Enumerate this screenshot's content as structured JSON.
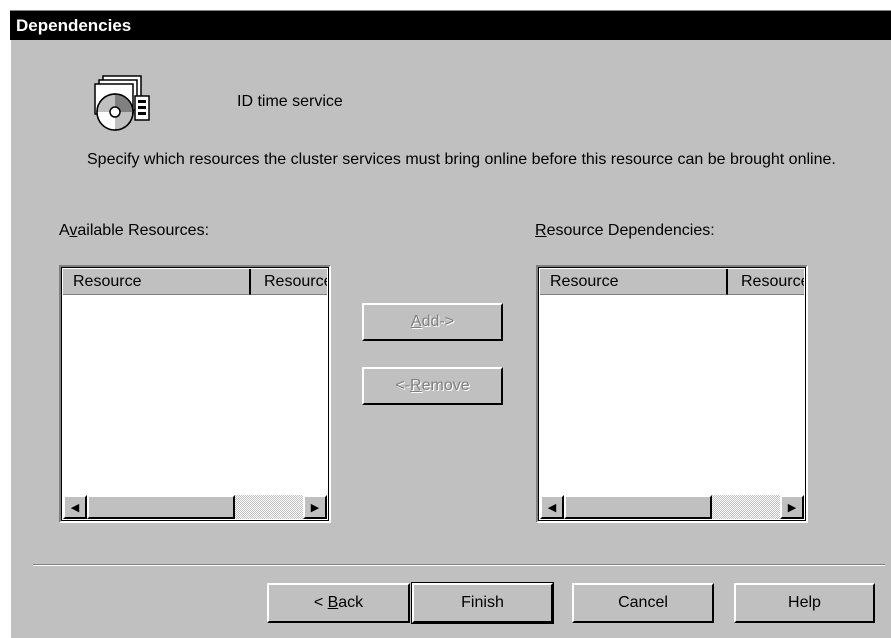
{
  "window": {
    "title": "Dependencies"
  },
  "resource_name": "ID time service",
  "instructions": "Specify which resources the cluster services must bring online before this resource can be brought online.",
  "available": {
    "label_pre": "A",
    "label_mnemonic": "v",
    "label_post": "ailable Resources:",
    "columns": [
      "Resource",
      "Resource Type"
    ],
    "items": []
  },
  "dependencies": {
    "label_pre": "",
    "label_mnemonic": "R",
    "label_post": "esource Dependencies:",
    "columns": [
      "Resource",
      "Resource Type"
    ],
    "items": []
  },
  "buttons": {
    "add": {
      "pre": "",
      "mnemonic": "A",
      "post": "dd->",
      "enabled": false
    },
    "remove": {
      "pre": "<-",
      "mnemonic": "R",
      "post": "emove",
      "enabled": false
    },
    "back": {
      "pre": "< ",
      "mnemonic": "B",
      "post": "ack"
    },
    "finish": "Finish",
    "cancel": "Cancel",
    "help": "Help"
  },
  "icons": {
    "resource": "cluster-resource-icon",
    "scroll_left": "arrow-left-icon",
    "scroll_right": "arrow-right-icon"
  }
}
